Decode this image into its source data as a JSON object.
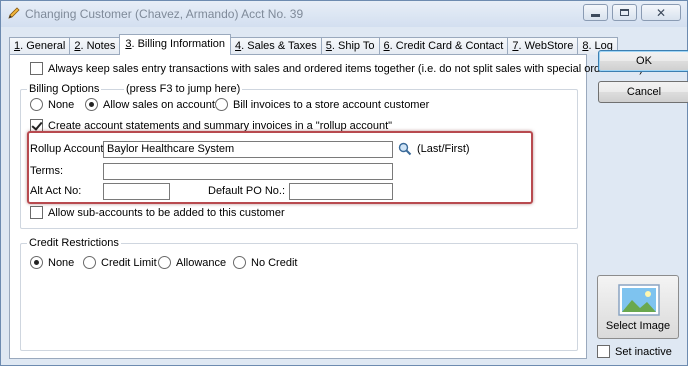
{
  "window": {
    "title": "Changing Customer  (Chavez, Armando)  Acct No. 39"
  },
  "tabs": [
    {
      "key": "1",
      "label": ". General"
    },
    {
      "key": "2",
      "label": ". Notes"
    },
    {
      "key": "3",
      "label": ". Billing Information"
    },
    {
      "key": "4",
      "label": ". Sales & Taxes"
    },
    {
      "key": "5",
      "label": ". Ship To"
    },
    {
      "key": "6",
      "label": ". Credit Card & Contact"
    },
    {
      "key": "7",
      "label": ". WebStore"
    },
    {
      "key": "8",
      "label": ". Log"
    }
  ],
  "active_tab_index": 2,
  "billing": {
    "keep_together_label": "Always keep sales entry transactions with sales and ordered items together (i.e. do not split sales with special order items)",
    "keep_together_checked": false,
    "options_title": "Billing Options",
    "options_hint": "(press F3 to jump here)",
    "radio_none": "None",
    "radio_allow_sales": "Allow sales on account",
    "radio_bill_invoices": "Bill invoices to a store account customer",
    "selected_option": "Allow sales on account",
    "create_statements_label": "Create account statements and summary invoices in a \"rollup account\"",
    "create_statements_checked": true,
    "rollup_label": "Rollup Account:",
    "rollup_value": "Baylor Healthcare System",
    "rollup_hint": "(Last/First)",
    "terms_label": "Terms:",
    "terms_value": "",
    "alt_act_label": "Alt Act No:",
    "alt_act_value": "",
    "default_po_label": "Default PO No.:",
    "default_po_value": "",
    "sub_accounts_label": "Allow sub-accounts to be added to this customer",
    "sub_accounts_checked": false
  },
  "credit": {
    "title": "Credit Restrictions",
    "radio_none": "None",
    "radio_credit_limit": "Credit Limit",
    "radio_allowance": "Allowance",
    "radio_no_credit": "No Credit",
    "selected": "None"
  },
  "buttons": {
    "ok": "OK",
    "cancel": "Cancel",
    "select_image": "Select Image"
  },
  "set_inactive": {
    "label": "Set inactive",
    "checked": false
  },
  "colors": {
    "highlight_border": "#b84a4f",
    "window_bg": "#dfe8f3"
  }
}
